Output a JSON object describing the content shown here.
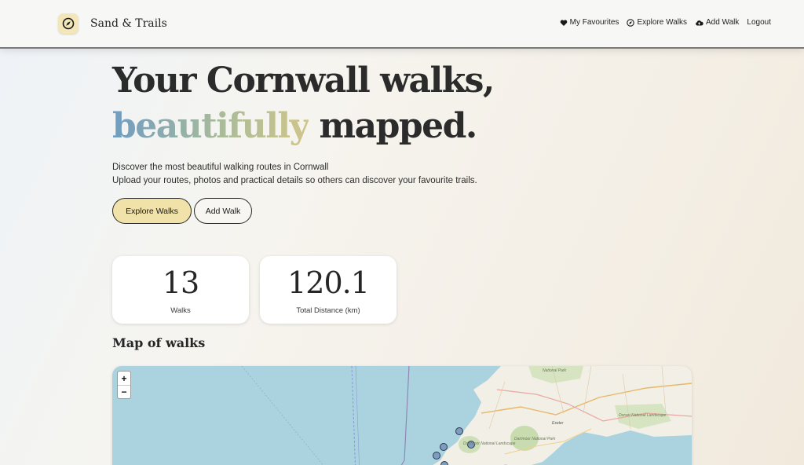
{
  "header": {
    "brand_name": "Sand & Trails",
    "nav": [
      {
        "label": "My Favourites",
        "icon": "heart-icon"
      },
      {
        "label": "Explore Walks",
        "icon": "compass-icon"
      },
      {
        "label": "Add Walk",
        "icon": "cloud-upload-icon"
      },
      {
        "label": "Logout",
        "icon": ""
      }
    ]
  },
  "hero": {
    "title_line1": "Your Cornwall walks,",
    "title_accent": "beautifully",
    "title_line2_rest": " mapped.",
    "subtitle_line1": "Discover the most beautiful walking routes in Cornwall",
    "subtitle_line2": "Upload your routes, photos and practical details so others can discover your favourite trails."
  },
  "actions": {
    "explore_label": "Explore Walks",
    "add_label": "Add Walk"
  },
  "stats": [
    {
      "value": "13",
      "label": "Walks"
    },
    {
      "value": "120.1",
      "label": "Total Distance (km)"
    }
  ],
  "map_section": {
    "title": "Map of walks",
    "zoom_in": "+",
    "zoom_out": "−",
    "place_labels": [
      "National Park",
      "Exeter",
      "Dartmoor National Park",
      "Dartmoor National Landscape",
      "Dorset National Landscape"
    ]
  },
  "colors": {
    "accent_button": "#f0e2a8",
    "sea": "#abd3df",
    "land": "#f2efe6",
    "marker": "#7e9cc0"
  }
}
